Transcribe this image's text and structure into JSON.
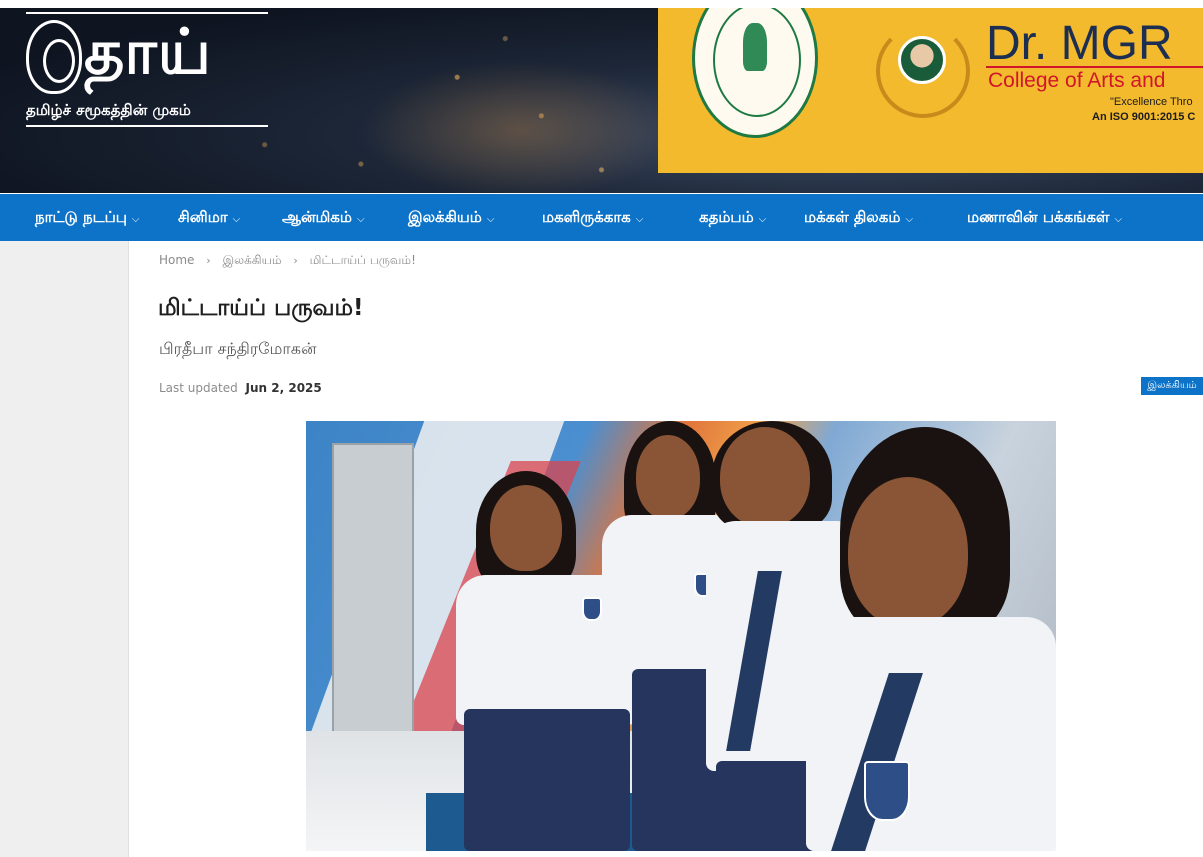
{
  "header": {
    "logo_title": "தாய்",
    "logo_tagline": "தமிழ்ச் சமூகத்தின் முகம்",
    "ad": {
      "name": "Dr. MGR",
      "college": "College of Arts and",
      "motto": "\"Excellence Thro",
      "iso": "An ISO 9001:2015 C",
      "colors": {
        "background": "#f4ba2e",
        "name": "#1c2f52",
        "college": "#d1152a"
      }
    }
  },
  "nav": {
    "color": "#0d73c9",
    "items": [
      {
        "label": "நாட்டு நடப்பு"
      },
      {
        "label": "சினிமா"
      },
      {
        "label": "ஆன்மிகம்"
      },
      {
        "label": "இலக்கியம்"
      },
      {
        "label": "மகளிருக்காக"
      },
      {
        "label": "கதம்பம்"
      },
      {
        "label": "மக்கள் திலகம்"
      },
      {
        "label": "மணாவின் பக்கங்கள்"
      }
    ],
    "chevron_icon": "chevron-down-icon"
  },
  "breadcrumb": {
    "home": "Home",
    "category": "இலக்கியம்",
    "current": "மிட்டாய்ப் பருவம்!",
    "separator_icon": "chevron-right-icon"
  },
  "article": {
    "title": "மிட்டாய்ப் பருவம்!",
    "author": "பிரதீபா சந்திரமோகன்",
    "updated_label": "Last updated",
    "updated_date": "Jun 2, 2025",
    "category_badge": "இலக்கியம்"
  }
}
